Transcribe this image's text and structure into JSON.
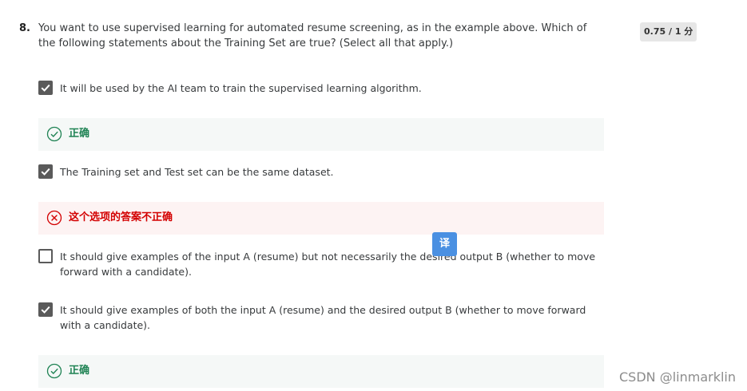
{
  "question": {
    "number": "8.",
    "text": "You want to use supervised learning for automated resume screening, as in the example above. Which of the following statements about the Training Set are true? (Select all that apply.)",
    "score": "0.75 / 1 分"
  },
  "options": [
    {
      "label": "It will be used by the AI team to train the supervised learning algorithm.",
      "checked": true,
      "feedback": {
        "status": "correct",
        "text": "正确"
      }
    },
    {
      "label": "The Training set and Test set can be the same dataset.",
      "checked": true,
      "feedback": {
        "status": "incorrect",
        "text": "这个选项的答案不正确"
      }
    },
    {
      "label": "It should give examples of the input A (resume) but not necessarily the desired output B (whether to move forward with a candidate).",
      "checked": false
    },
    {
      "label": "It should give examples of both the input A (resume) and the desired output B (whether to move forward with a candidate).",
      "checked": true,
      "feedback": {
        "status": "correct",
        "text": "正确"
      }
    }
  ],
  "translate_button": {
    "label": "译"
  },
  "watermark": "CSDN @linmarklin",
  "colors": {
    "correct": "#1f8354",
    "incorrect": "#d30001",
    "checkbox": "#5a5a5a",
    "translate_bg": "#4a90e2"
  },
  "icons": {
    "checked": "check-mark-icon",
    "correct": "check-circle-icon",
    "incorrect": "x-circle-icon"
  }
}
